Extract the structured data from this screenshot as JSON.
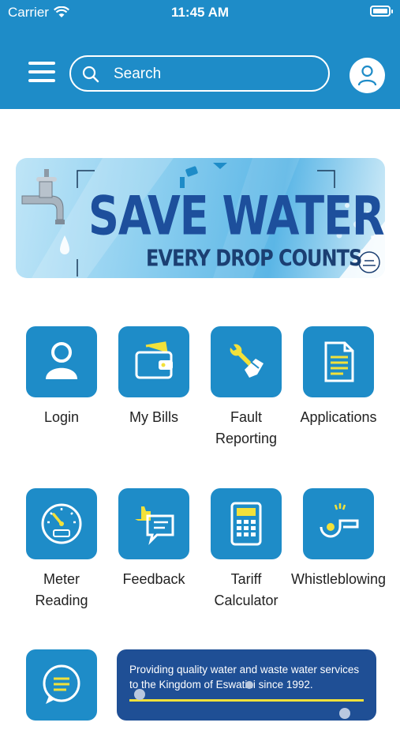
{
  "status_bar": {
    "carrier": "Carrier",
    "time": "11:45 AM"
  },
  "header": {
    "search_placeholder": "Search"
  },
  "banner": {
    "title": "SAVE WATER",
    "subtitle": "EVERY DROP COUNTS"
  },
  "tiles": [
    {
      "label": "Login",
      "icon": "user-icon"
    },
    {
      "label": "My Bills",
      "icon": "wallet-icon"
    },
    {
      "label": "Fault\nReporting",
      "icon": "wrench-icon"
    },
    {
      "label": "Applications",
      "icon": "document-icon"
    },
    {
      "label": "Meter\nReading",
      "icon": "gauge-icon"
    },
    {
      "label": "Feedback",
      "icon": "feedback-icon"
    },
    {
      "label": "Tariff\nCalculator",
      "icon": "calculator-icon"
    },
    {
      "label": "Whistleblowing",
      "icon": "whistle-icon"
    },
    {
      "label": "",
      "icon": "chat-icon"
    }
  ],
  "info_card": {
    "text": "Providing quality water and waste water services to the Kingdom of Eswatini since 1992."
  },
  "colors": {
    "primary": "#1e8cc8",
    "accent": "#f2e13a",
    "dark_blue": "#1f4f95"
  }
}
